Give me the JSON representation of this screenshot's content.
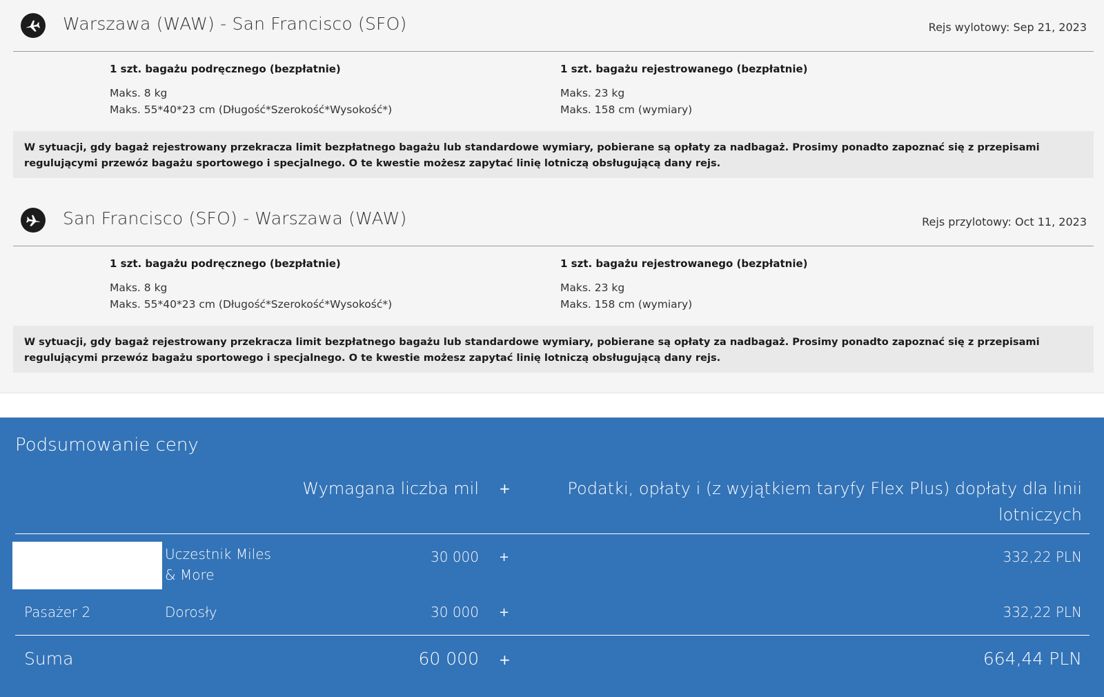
{
  "segments": [
    {
      "route": "Warszawa (WAW) - San Francisco (SFO)",
      "date_label": "Rejs wylotowy: Sep 21, 2023",
      "icon": "plane-departure-icon",
      "carry_on": {
        "title": "1 szt. bagażu podręcznego (bezpłatnie)",
        "weight": "Maks. 8 kg",
        "dimensions": "Maks. 55*40*23 cm (Długość*Szerokość*Wysokość*)"
      },
      "checked": {
        "title": "1 szt. bagażu rejestrowanego (bezpłatnie)",
        "weight": "Maks. 23 kg",
        "dimensions": "Maks. 158 cm (wymiary)"
      },
      "notice": "W sytuacji, gdy bagaż rejestrowany przekracza limit bezpłatnego bagażu lub standardowe wymiary, pobierane są opłaty za nadbagaż. Prosimy ponadto zapoznać się z przepisami regulującymi przewóz bagażu sportowego i specjalnego. O te kwestie możesz zapytać linię lotniczą obsługującą dany rejs."
    },
    {
      "route": "San Francisco (SFO) - Warszawa (WAW)",
      "date_label": "Rejs przylotowy: Oct 11, 2023",
      "icon": "plane-arrival-icon",
      "carry_on": {
        "title": "1 szt. bagażu podręcznego (bezpłatnie)",
        "weight": "Maks. 8 kg",
        "dimensions": "Maks. 55*40*23 cm (Długość*Szerokość*Wysokość*)"
      },
      "checked": {
        "title": "1 szt. bagażu rejestrowanego (bezpłatnie)",
        "weight": "Maks. 23 kg",
        "dimensions": "Maks. 158 cm (wymiary)"
      },
      "notice": "W sytuacji, gdy bagaż rejestrowany przekracza limit bezpłatnego bagażu lub standardowe wymiary, pobierane są opłaty za nadbagaż. Prosimy ponadto zapoznać się z przepisami regulującymi przewóz bagażu sportowego i specjalnego. O te kwestie możesz zapytać linię lotniczą obsługującą dany rejs."
    }
  ],
  "summary": {
    "title": "Podsumowanie ceny",
    "header_miles": "Wymagana liczba mil",
    "header_plus": "+",
    "header_taxes": "Podatki, opłaty i (z wyjątkiem taryfy Flex Plus) dopłaty dla linii lotniczych",
    "rows": [
      {
        "name": "",
        "type": "Uczestnik Miles & More",
        "miles": "30 000",
        "plus": "+",
        "amount": "332,22 PLN"
      },
      {
        "name": "Pasażer 2",
        "type": "Dorosły",
        "miles": "30 000",
        "plus": "+",
        "amount": "332,22 PLN"
      }
    ],
    "total": {
      "label": "Suma",
      "miles": "60 000",
      "plus": "+",
      "amount": "664,44 PLN"
    }
  },
  "colors": {
    "summary_background": "#3373b7",
    "panel_background": "#f5f5f5",
    "notice_background": "#e9e9e9"
  }
}
